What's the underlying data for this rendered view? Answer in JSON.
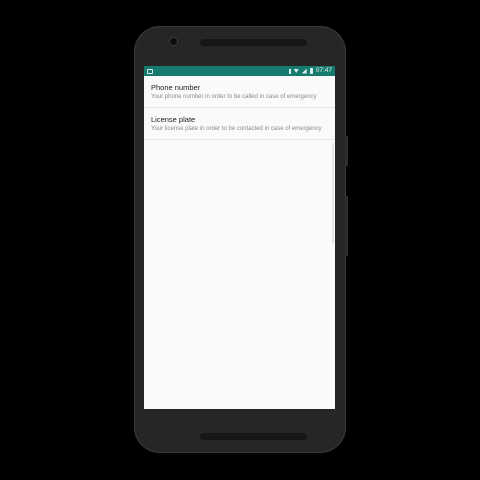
{
  "status_bar": {
    "time": "07:47",
    "icons": [
      "save-icon",
      "bluetooth-icon",
      "wifi-icon",
      "signal-icon",
      "battery-icon"
    ],
    "color": "#167a6e"
  },
  "settings": {
    "items": [
      {
        "title": "Phone number",
        "summary": "Your phone number in order to be called in case of emergency"
      },
      {
        "title": "License plate",
        "summary": "Your license plate in order to be contacted in case of emergency"
      }
    ]
  }
}
